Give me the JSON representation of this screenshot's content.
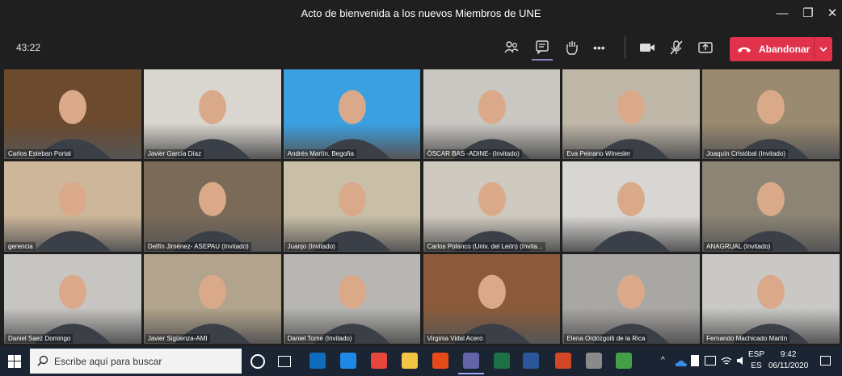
{
  "window": {
    "title": "Acto de bienvenida a los nuevos Miembros de UNE",
    "minimize_glyph": "—",
    "maximize_glyph": "❐",
    "close_glyph": "✕"
  },
  "meeting": {
    "timer": "43:22",
    "toolbar_icons": [
      "participants-icon",
      "chat-icon",
      "raise-hand-icon",
      "more-options-icon",
      "camera-icon",
      "mic-muted-icon",
      "share-screen-icon"
    ],
    "more_glyph": "•••",
    "leave_label": "Abandonar",
    "leave_color": "#e0324b"
  },
  "participants": [
    {
      "name": "Carlos Esteban Portal",
      "bg": "#6b4a2e"
    },
    {
      "name": "Javier García Díaz",
      "bg": "#d9d6cf"
    },
    {
      "name": "Andrés Martín, Begoña",
      "bg": "#3aa0e0"
    },
    {
      "name": "ÓSCAR BAS -ADINE- (Invitado)",
      "bg": "#c9c7c2"
    },
    {
      "name": "Eva Peinano Winesler",
      "bg": "#bfb7a8"
    },
    {
      "name": "Joaquín Cristóbal (Invitado)",
      "bg": "#9a8a70"
    },
    {
      "name": "gerencia",
      "bg": "#cdb69a"
    },
    {
      "name": "Delfín Jiménez- ASEPAU (Invitado)",
      "bg": "#7a6a58"
    },
    {
      "name": "Juanjo (Invitado)",
      "bg": "#c9bfa6"
    },
    {
      "name": "Carlos Polanco (Univ. del León) (Invita...",
      "bg": "#cfcac0"
    },
    {
      "name": "",
      "bg": "#d8d6d3"
    },
    {
      "name": "ANAGRUAL (Invitado)",
      "bg": "#8c8474"
    },
    {
      "name": "Daniel Saez Domingo",
      "bg": "#c7c5c2"
    },
    {
      "name": "Javier Sigüenza-AMI",
      "bg": "#b2a48c"
    },
    {
      "name": "Daniel Tomé (Invitado)",
      "bg": "#b7b6b2"
    },
    {
      "name": "Virginia Vidal Acero",
      "bg": "#8b5a3a"
    },
    {
      "name": "Elena Ordozgoiti de la Rica",
      "bg": "#a9a7a4"
    },
    {
      "name": "Fernando Machicado Martín",
      "bg": "#c9c8c4"
    }
  ],
  "taskbar": {
    "search_placeholder": "Escribe aquí para buscar",
    "apps": [
      "cortana-icon",
      "task-view-icon",
      "outlook-icon",
      "edge-icon",
      "chrome-icon",
      "file-explorer-icon",
      "brave-icon",
      "teams-icon",
      "excel-icon",
      "word-icon",
      "powerpoint-icon",
      "calculator-icon",
      "globe-icon"
    ],
    "tray_chevron": "^",
    "lang_top": "ESP",
    "lang_bottom": "ES",
    "time": "9:42",
    "date": "06/11/2020"
  }
}
